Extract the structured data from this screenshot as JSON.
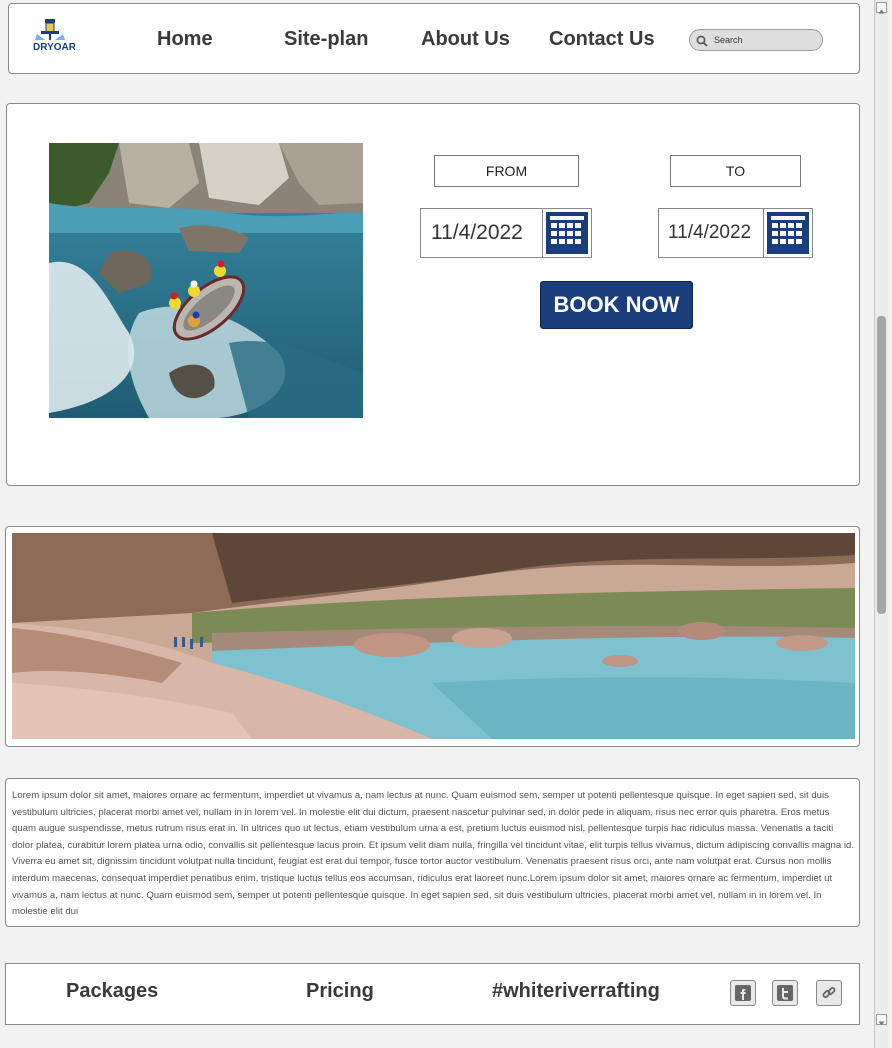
{
  "header": {
    "logo_alt": "DRYOAR",
    "nav": {
      "home": "Home",
      "siteplan": "Site-plan",
      "about": "About Us",
      "contact": "Contact Us"
    },
    "search": {
      "placeholder": "Search",
      "icon": "search-icon"
    }
  },
  "booking": {
    "from_label": "FROM",
    "to_label": "TO",
    "from_date": "11/4/2022",
    "to_date": "11/4/2022",
    "calendar_icon": "calendar-icon",
    "book_label": "BOOK NOW"
  },
  "body_text": "Lorem ipsum dolor sit amet, maiores ornare ac fermentum, imperdiet ut vivamus a, nam lectus at nunc. Quam euismod sem, semper ut potenti pellentesque quisque. In eget sapien sed, sit duis vestibulum ultricies, placerat morbi amet vel, nullam in in lorem vel. In molestie elit dui dictum, praesent nascetur pulvinar sed, in dolor pede in aliquam, risus nec error quis pharetra. Eros metus quam augue suspendisse, metus rutrum risus erat in.  In ultrices quo ut lectus, etiam vestibulum urna a est, pretium luctus euismod nisl, pellentesque turpis hac ridiculus massa. Venenatis a taciti dolor platea, curabitur lorem platea urna odio, convallis sit pellentesque lacus proin. Et ipsum velit diam nulla, fringilla vel tincidunt vitae, elit turpis tellus vivamus, dictum adipiscing convallis magna id. Viverra eu amet sit, dignissim tincidunt volutpat nulla tincidunt, feugiat est erat dui tempor, fusce tortor auctor vestibulum. Venenatis praesent risus orci, ante nam volutpat erat. Cursus non mollis interdum maecenas, consequat imperdiet penatibus enim, tristique luctus tellus eos accumsan, ridiculus erat laoreet nunc.Lorem ipsum dolor sit amet, maiores ornare ac fermentum, imperdiet ut vivamus a, nam lectus at nunc. Quam euismod sem, semper ut potenti pellentesque quisque. In eget sapien sed, sit duis vestibulum ultricies, placerat morbi amet vel, nullam in in lorem vel. In molestie elit dui",
  "footer": {
    "packages": "Packages",
    "pricing": "Pricing",
    "hashtag": "#whiteriverrafting",
    "social_icons": [
      "facebook-icon",
      "twitter-icon",
      "link-icon"
    ]
  },
  "colors": {
    "brand_blue": "#1a3d7c",
    "panel_border": "#8a8a8a",
    "page_bg": "#f2f2f2"
  }
}
